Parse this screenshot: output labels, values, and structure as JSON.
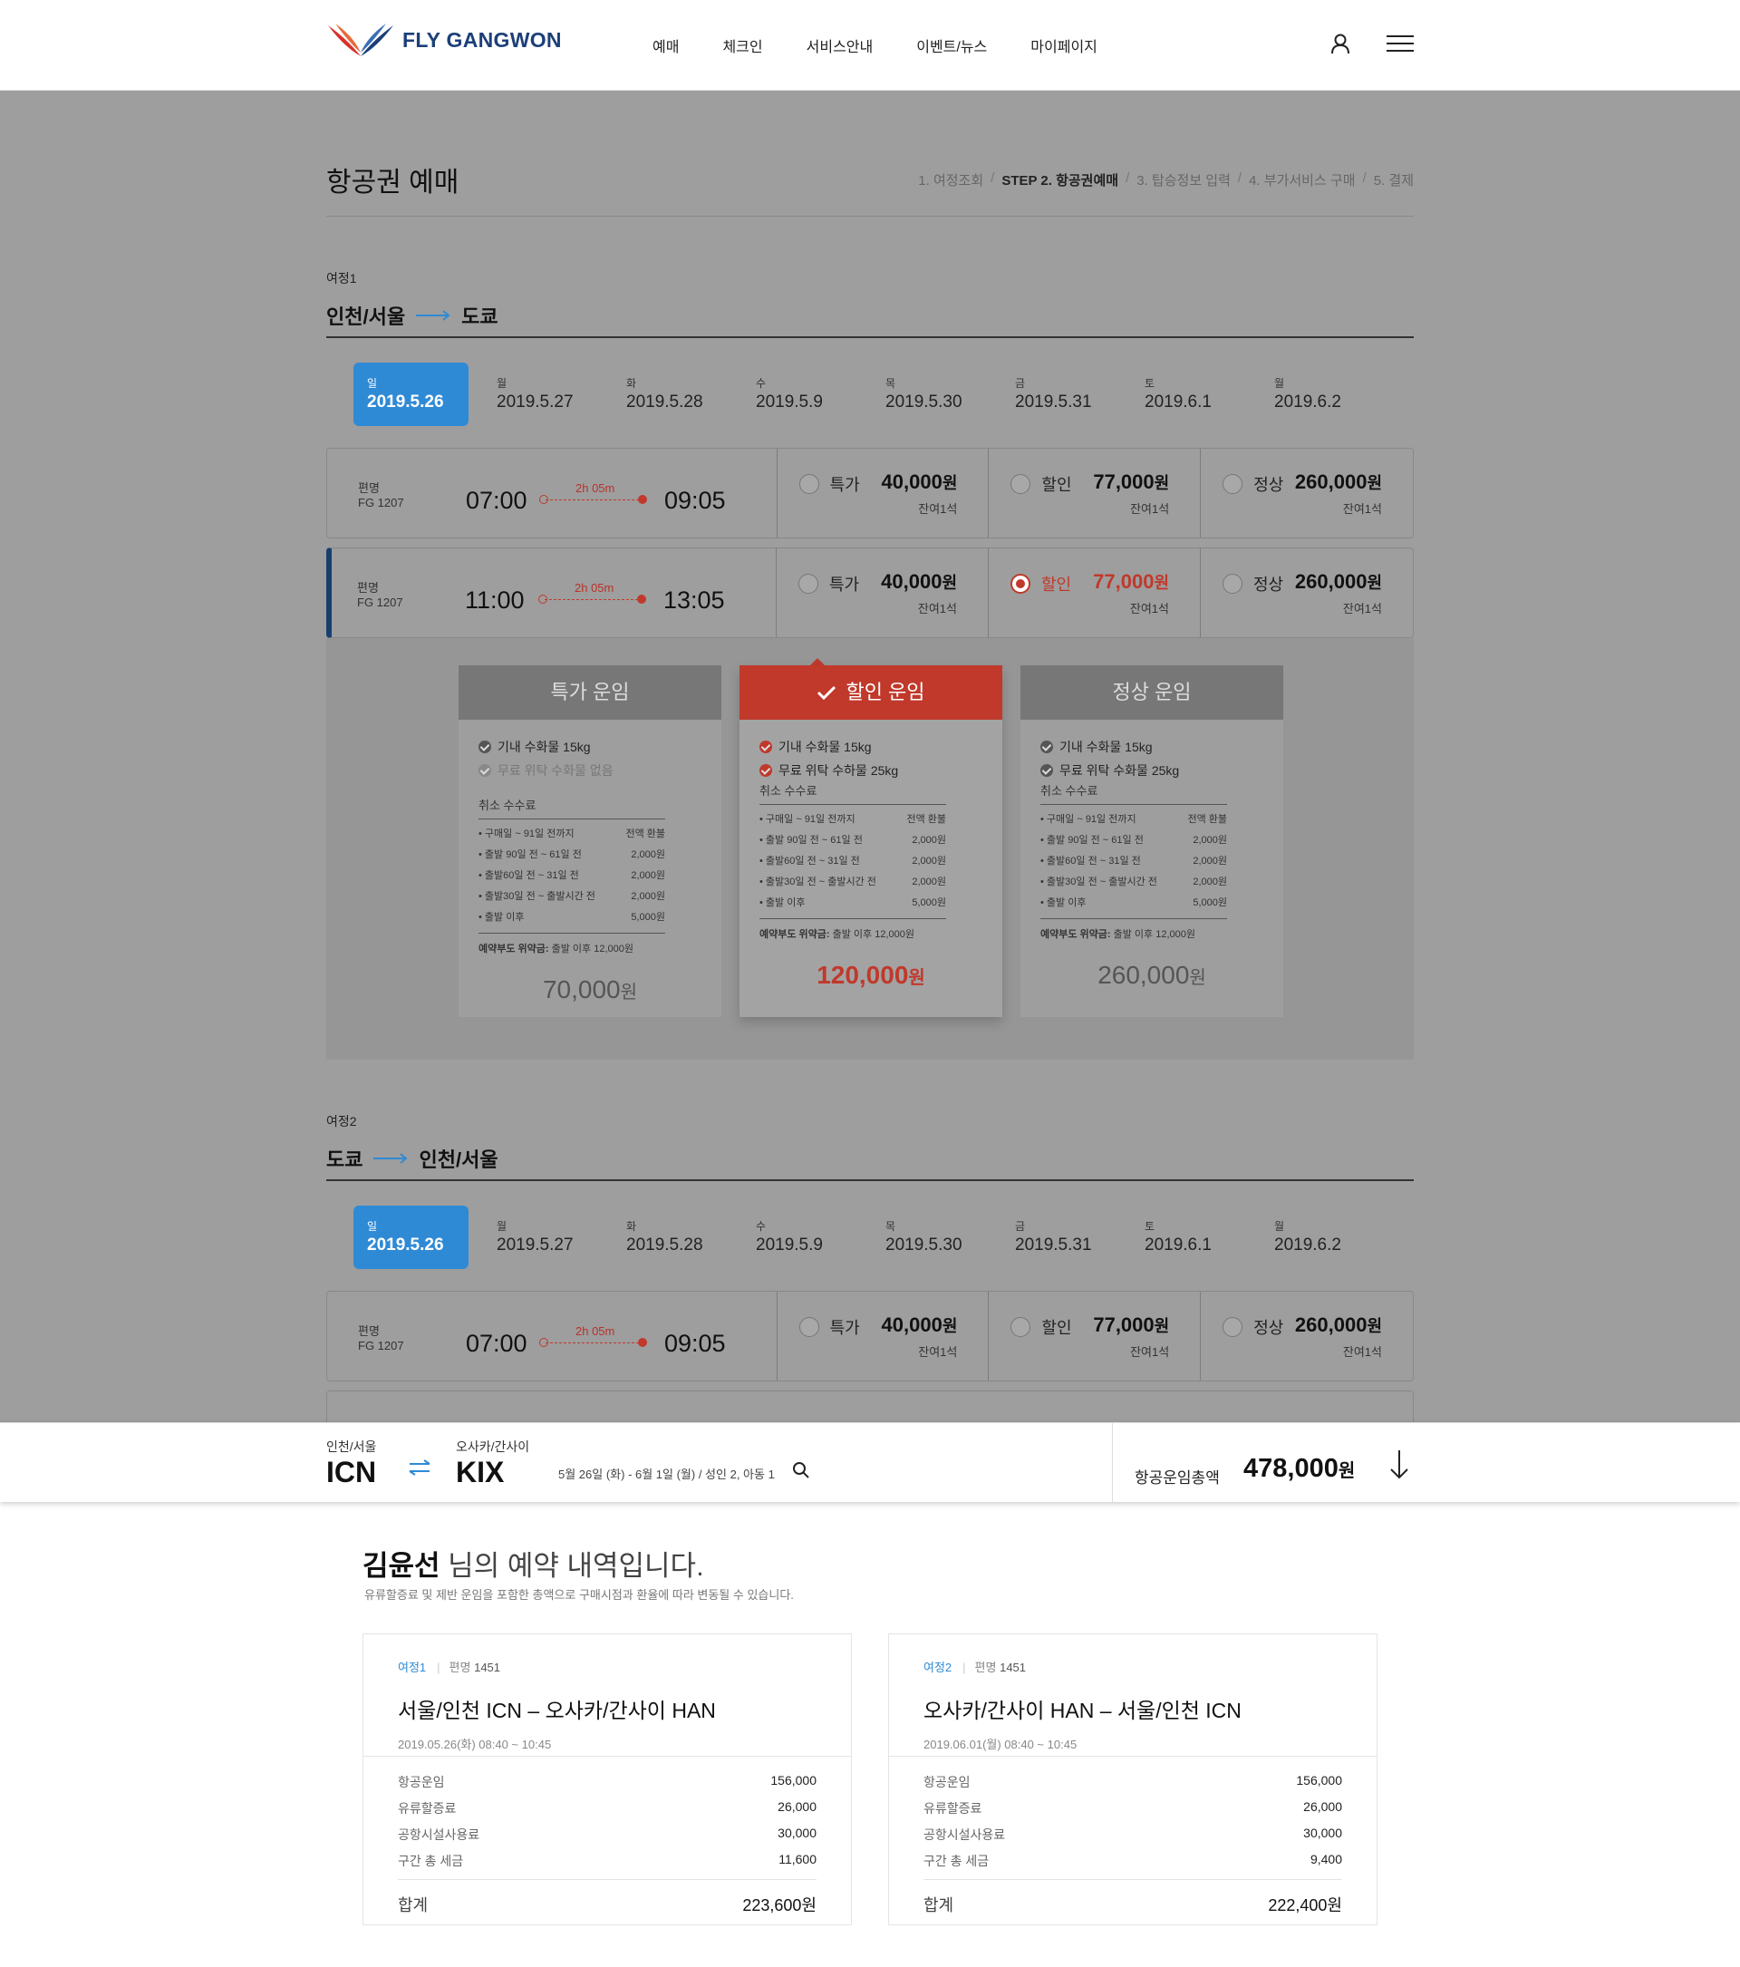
{
  "header": {
    "logo_text": "FLY GANGWON",
    "nav": [
      "예매",
      "체크인",
      "서비스안내",
      "이벤트/뉴스",
      "마이페이지"
    ],
    "icons": [
      "user-icon",
      "menu-icon"
    ]
  },
  "page": {
    "title": "항공권 예매",
    "steps": [
      {
        "label": "1. 여정조회",
        "current": false
      },
      {
        "label": "STEP 2. 항공권예매",
        "current": true
      },
      {
        "label": "3. 탑승정보 입력",
        "current": false
      },
      {
        "label": "4. 부가서비스 구매",
        "current": false
      },
      {
        "label": "5. 결제",
        "current": false
      }
    ]
  },
  "journeys": [
    {
      "label": "여정1",
      "from": "인천/서울",
      "to": "도쿄",
      "dates": [
        {
          "dow": "일",
          "date": "2019.5.26"
        },
        {
          "dow": "월",
          "date": "2019.5.27"
        },
        {
          "dow": "화",
          "date": "2019.5.28"
        },
        {
          "dow": "수",
          "date": "2019.5.9"
        },
        {
          "dow": "목",
          "date": "2019.5.30"
        },
        {
          "dow": "금",
          "date": "2019.5.31"
        },
        {
          "dow": "토",
          "date": "2019.6.1"
        },
        {
          "dow": "월",
          "date": "2019.6.2"
        }
      ],
      "flights": [
        {
          "no_label": "편명",
          "no": "FG 1207",
          "dep": "07:00",
          "arr": "09:05",
          "dur": "2h 05m",
          "fares": [
            {
              "type": "특가",
              "price": "40,000",
              "unit": "원",
              "seats": "잔여1석"
            },
            {
              "type": "할인",
              "price": "77,000",
              "unit": "원",
              "seats": "잔여1석"
            },
            {
              "type": "정상",
              "price": "260,000",
              "unit": "원",
              "seats": "잔여1석"
            }
          ]
        },
        {
          "no_label": "편명",
          "no": "FG 1207",
          "dep": "11:00",
          "arr": "13:05",
          "dur": "2h 05m",
          "fares": [
            {
              "type": "특가",
              "price": "40,000",
              "unit": "원",
              "seats": "잔여1석"
            },
            {
              "type": "할인",
              "price": "77,000",
              "unit": "원",
              "seats": "잔여1석"
            },
            {
              "type": "정상",
              "price": "260,000",
              "unit": "원",
              "seats": "잔여1석"
            }
          ]
        }
      ]
    },
    {
      "label": "여정2",
      "from": "도쿄",
      "to": "인천/서울",
      "dates": [
        {
          "dow": "일",
          "date": "2019.5.26"
        },
        {
          "dow": "월",
          "date": "2019.5.27"
        },
        {
          "dow": "화",
          "date": "2019.5.28"
        },
        {
          "dow": "수",
          "date": "2019.5.9"
        },
        {
          "dow": "목",
          "date": "2019.5.30"
        },
        {
          "dow": "금",
          "date": "2019.5.31"
        },
        {
          "dow": "토",
          "date": "2019.6.1"
        },
        {
          "dow": "월",
          "date": "2019.6.2"
        }
      ],
      "flights": [
        {
          "no_label": "편명",
          "no": "FG 1207",
          "dep": "07:00",
          "arr": "09:05",
          "dur": "2h 05m",
          "fares": [
            {
              "type": "특가",
              "price": "40,000",
              "unit": "원",
              "seats": "잔여1석"
            },
            {
              "type": "할인",
              "price": "77,000",
              "unit": "원",
              "seats": "잔여1석"
            },
            {
              "type": "정상",
              "price": "260,000",
              "unit": "원",
              "seats": "잔여1석"
            }
          ]
        }
      ]
    }
  ],
  "fare_cards": [
    {
      "title": "특가 운임",
      "items": [
        {
          "text": "기내 수화물 15kg",
          "on": true
        },
        {
          "text": "무료 위탁 수화물 없음",
          "on": false
        }
      ],
      "cancel_title": "취소 수수료",
      "rows": [
        [
          "구매일 ~ 91일 전까지",
          "전액 환불"
        ],
        [
          "출발 90일 전 ~ 61일 전",
          "2,000원"
        ],
        [
          "출발60일 전 ~ 31일 전",
          "2,000원"
        ],
        [
          "출발30일 전 ~ 출발시간 전",
          "2,000원"
        ],
        [
          "출발 이후",
          "5,000원"
        ]
      ],
      "penalty_label": "예약부도 위약금:",
      "penalty_text": "출발 이후 12,000원",
      "amount": "70,000",
      "unit": "원"
    },
    {
      "title": "할인 운임",
      "items": [
        {
          "text": "기내 수화물 15kg",
          "on": true
        },
        {
          "text": "무료 위탁 수하물 25kg",
          "on": true
        }
      ],
      "cancel_title": "취소 수수료",
      "rows": [
        [
          "구매일 ~ 91일 전까지",
          "전액 환불"
        ],
        [
          "출발 90일 전 ~ 61일 전",
          "2,000원"
        ],
        [
          "출발60일 전 ~ 31일 전",
          "2,000원"
        ],
        [
          "출발30일 전 ~ 출발시간 전",
          "2,000원"
        ],
        [
          "출발 이후",
          "5,000원"
        ]
      ],
      "penalty_label": "예약부도 위약금:",
      "penalty_text": "출발 이후 12,000원",
      "amount": "120,000",
      "unit": "원"
    },
    {
      "title": "정상 운임",
      "items": [
        {
          "text": "기내 수화물 15kg",
          "on": true
        },
        {
          "text": "무료 위탁 수화물 25kg",
          "on": true
        }
      ],
      "cancel_title": "취소 수수료",
      "rows": [
        [
          "구매일 ~ 91일 전까지",
          "전액 환불"
        ],
        [
          "출발 90일 전 ~ 61일 전",
          "2,000원"
        ],
        [
          "출발60일 전 ~ 31일 전",
          "2,000원"
        ],
        [
          "출발30일 전 ~ 출발시간 전",
          "2,000원"
        ],
        [
          "출발 이후",
          "5,000원"
        ]
      ],
      "penalty_label": "예약부도 위약금:",
      "penalty_text": "출발 이후 12,000원",
      "amount": "260,000",
      "unit": "원"
    }
  ],
  "summary_bar": {
    "from_name": "인천/서울",
    "from_code": "ICN",
    "to_name": "오사카/간사이",
    "to_code": "KIX",
    "info": "5월 26일 (화) - 6월 1일 (월) / 성인 2, 아동 1",
    "total_label": "항공운임총액",
    "total": "478,000",
    "total_unit": "원"
  },
  "reservation": {
    "name": "김윤선",
    "title_rest": " 님의 예약 내역입니다.",
    "note": "유류할증료 및 제반 운임을 포함한 총액으로  구매시점과 환율에 따라 변동될 수 있습니다.",
    "cards": [
      {
        "journey": "여정1",
        "flight_label": "편명",
        "flight": "1451",
        "route": "서울/인천 ICN  –  오사카/간사이 HAN",
        "time": "2019.05.26(화) 08:40 ~ 10:45",
        "rows": [
          [
            "항공운임",
            "156,000"
          ],
          [
            "유류할증료",
            "26,000"
          ],
          [
            "공항시설사용료",
            "30,000"
          ],
          [
            "구간 총 세금",
            "11,600"
          ]
        ],
        "total_label": "합계",
        "total": "223,600원"
      },
      {
        "journey": "여정2",
        "flight_label": "편명",
        "flight": "1451",
        "route": "오사카/간사이 HAN  –  서울/인천 ICN",
        "time": "2019.06.01(월) 08:40 ~ 10:45",
        "rows": [
          [
            "항공운임",
            "156,000"
          ],
          [
            "유류할증료",
            "26,000"
          ],
          [
            "공항시설사용료",
            "30,000"
          ],
          [
            "구간 총 세금",
            "9,400"
          ]
        ],
        "total_label": "합계",
        "total": "222,400원"
      }
    ]
  },
  "colors": {
    "accent_blue": "#2f8ad6",
    "accent_red": "#c0392b",
    "navy": "#1c3f7a",
    "overlay_gray": "#9e9e9e"
  }
}
